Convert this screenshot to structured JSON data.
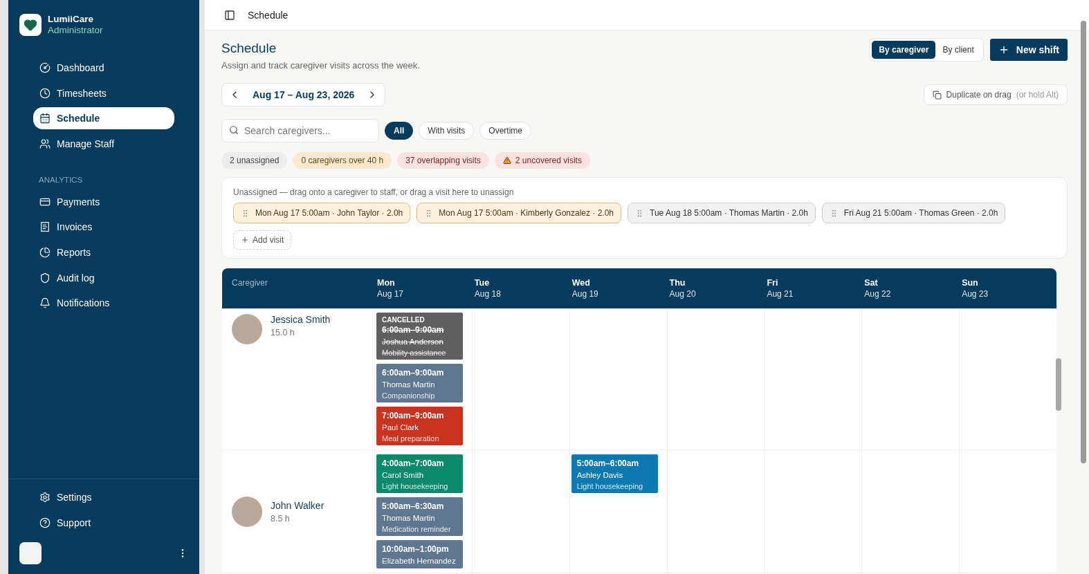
{
  "brand": {
    "name": "LumiiCare",
    "role": "Administrator"
  },
  "sidebar": {
    "items": [
      {
        "label": "Dashboard",
        "selected": false
      },
      {
        "label": "Timesheets",
        "selected": false
      },
      {
        "label": "Schedule",
        "selected": true
      },
      {
        "label": "Manage Staff",
        "selected": false
      }
    ],
    "section_title": "ANALYTICS",
    "analytics_items": [
      {
        "label": "Payments",
        "selected": false
      },
      {
        "label": "Invoices",
        "selected": false
      },
      {
        "label": "Reports",
        "selected": false
      },
      {
        "label": "Audit log",
        "selected": false
      },
      {
        "label": "Notifications",
        "selected": false
      }
    ],
    "footer_items": [
      {
        "label": "Settings",
        "selected": false
      },
      {
        "label": "Support",
        "selected": false
      }
    ]
  },
  "topbar": {
    "breadcrumb": "Schedule"
  },
  "header": {
    "title": "Schedule",
    "subtitle": "Assign and track caregiver visits across the week.",
    "view_toggle": [
      {
        "label": "By caregiver",
        "selected": true
      },
      {
        "label": "By client",
        "selected": false
      }
    ],
    "new_button": "New shift"
  },
  "week": {
    "label": "Aug 17 – Aug 23, 2026"
  },
  "duplicate": {
    "label": "Duplicate on drag",
    "hint": "(or hold Alt)"
  },
  "search": {
    "placeholder": "Search caregivers..."
  },
  "filters": [
    {
      "label": "All",
      "selected": true
    },
    {
      "label": "With visits",
      "selected": false
    },
    {
      "label": "Overtime",
      "selected": false
    }
  ],
  "stats": [
    {
      "label": "2 unassigned",
      "kind": "neutral"
    },
    {
      "label": "0 caregivers over 40 h",
      "kind": "warning"
    },
    {
      "label": "37 overlapping visits",
      "kind": "danger"
    },
    {
      "label": "2 uncovered visits",
      "kind": "alert"
    }
  ],
  "unassigned": {
    "hint": "Unassigned — drag onto a caregiver to staff, or drag a visit here to unassign",
    "visits": [
      {
        "label": "Mon Aug 17 5:00am · John Taylor · 2.0h",
        "kind": "warning"
      },
      {
        "label": "Mon Aug 17 5:00am · Kimberly Gonzalez · 2.0h",
        "kind": "warning"
      },
      {
        "label": "Tue Aug 18 5:00am · Thomas Martin · 2.0h",
        "kind": "plain"
      },
      {
        "label": "Fri Aug 21 5:00am · Thomas Green · 2.0h",
        "kind": "plain"
      }
    ],
    "add_button": "Add visit"
  },
  "grid": {
    "caregiver_heading": "Caregiver",
    "days": [
      {
        "day": "Mon",
        "date": "Aug 17"
      },
      {
        "day": "Tue",
        "date": "Aug 18"
      },
      {
        "day": "Wed",
        "date": "Aug 19"
      },
      {
        "day": "Thu",
        "date": "Aug 20"
      },
      {
        "day": "Fri",
        "date": "Aug 21"
      },
      {
        "day": "Sat",
        "date": "Aug 22"
      },
      {
        "day": "Sun",
        "date": "Aug 23"
      }
    ],
    "rows": [
      {
        "name": "Jessica Smith",
        "hours": "15.0 h",
        "days": {
          "mon": [
            {
              "status": "CANCELLED",
              "cancelled": true,
              "time": "6:00am–9:00am",
              "client": "Joshua Anderson",
              "service": "Mobility assistance",
              "color": "#5f5f5f"
            },
            {
              "cancelled": false,
              "time": "6:00am–9:00am",
              "client": "Thomas Martin",
              "service": "Companionship",
              "color": "#5f7690"
            },
            {
              "cancelled": false,
              "time": "7:00am–9:00am",
              "client": "Paul Clark",
              "service": "Meal preparation",
              "color": "#c8321e"
            }
          ]
        }
      },
      {
        "name": "John Walker",
        "hours": "8.5 h",
        "days": {
          "mon": [
            {
              "cancelled": false,
              "time": "4:00am–7:00am",
              "client": "Carol Smith",
              "service": "Light housekeeping",
              "color": "#0b8a6a"
            },
            {
              "cancelled": false,
              "time": "5:00am–6:30am",
              "client": "Thomas Martin",
              "service": "Medication reminder",
              "color": "#5f7690"
            },
            {
              "cancelled": false,
              "time": "10:00am–1:00pm",
              "client": "Elizabeth Hernandez",
              "color": "#5f7690"
            }
          ],
          "wed": [
            {
              "cancelled": false,
              "time": "5:00am–6:00am",
              "client": "Ashley Davis",
              "service": "Light housekeeping",
              "color": "#0c79b0"
            }
          ]
        }
      }
    ]
  }
}
